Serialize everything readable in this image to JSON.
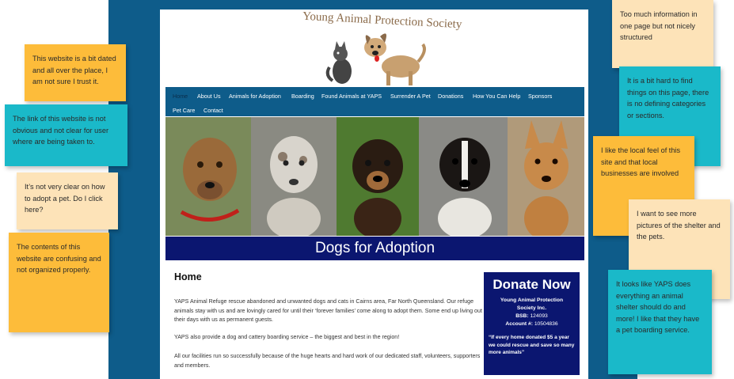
{
  "site": {
    "logo_text": "Young Animal Protection Society",
    "nav": [
      {
        "label": "Home",
        "active": true
      },
      {
        "label": "About Us"
      },
      {
        "label": "Animals for Adoption"
      },
      {
        "label": "Boarding"
      },
      {
        "label": "Found Animals at YAPS"
      },
      {
        "label": "Surrender A Pet"
      },
      {
        "label": "Donations"
      },
      {
        "label": "How You Can Help"
      },
      {
        "label": "Sponsors"
      },
      {
        "label": "Pet Care"
      },
      {
        "label": "Contact"
      }
    ],
    "banner_title": "Dogs for Adoption",
    "heading": "Home",
    "paragraphs": [
      "YAPS Animal Refuge rescue abandoned and unwanted dogs and cats in Cairns area, Far North Queensland. Our refuge animals stay with us and are lovingly cared for until their ‘forever families’ come along to adopt them.  Some end up living out their days with us as permanent guests.",
      "YAPS also provide a dog and cattery boarding service – the biggest and best in the region!",
      "All our facilities run so successfully because of the huge hearts and hard work of our dedicated staff, volunteers, supporters and members."
    ],
    "donate": {
      "title": "Donate Now",
      "org_line1": "Young Animal Protection",
      "org_line2": "Society Inc.",
      "bsb_label": "BSB:",
      "bsb_value": "124093",
      "account_label": "Account #:",
      "account_value": "10504836",
      "quote": "“If every home donated $5 a year we could rescue and save so many more animals”"
    }
  },
  "notes": {
    "left": [
      {
        "text": "This website is a bit dated and all over the place, I am not sure I trust it.",
        "color": "yellow"
      },
      {
        "text": "The link of this website is not obvious and not clear for user where are being taken to.",
        "color": "teal"
      },
      {
        "text": "It’s not very clear on how to adopt a pet. Do I click here?",
        "color": "cream"
      },
      {
        "text": "The contents of this website are confusing and not organized properly.",
        "color": "yellow"
      }
    ],
    "right": [
      {
        "text": "Too much information in one page but not nicely structured",
        "color": "cream"
      },
      {
        "text": "It is a bit hard to find things on this page, there is no defining categories or sections.",
        "color": "teal"
      },
      {
        "text": "I like the local feel of this site and that local businesses are involved",
        "color": "yellow"
      },
      {
        "text": "I want to see more pictures of the shelter and the pets.",
        "color": "cream"
      },
      {
        "text": "It looks like YAPS does everything an animal shelter should do and more! I like that they have a pet boarding service.",
        "color": "teal"
      }
    ]
  },
  "colors": {
    "board": "#0e5c8a",
    "nav": "#0e5c8a",
    "banner_title_bg": "#0b1670",
    "donate_bg": "#0b1670",
    "note_yellow": "#fdbc3a",
    "note_cream": "#fde3b8",
    "note_teal": "#1ab9c9"
  },
  "icons": [
    "dog-logo-icon",
    "cat-logo-icon",
    "dog-photo"
  ]
}
